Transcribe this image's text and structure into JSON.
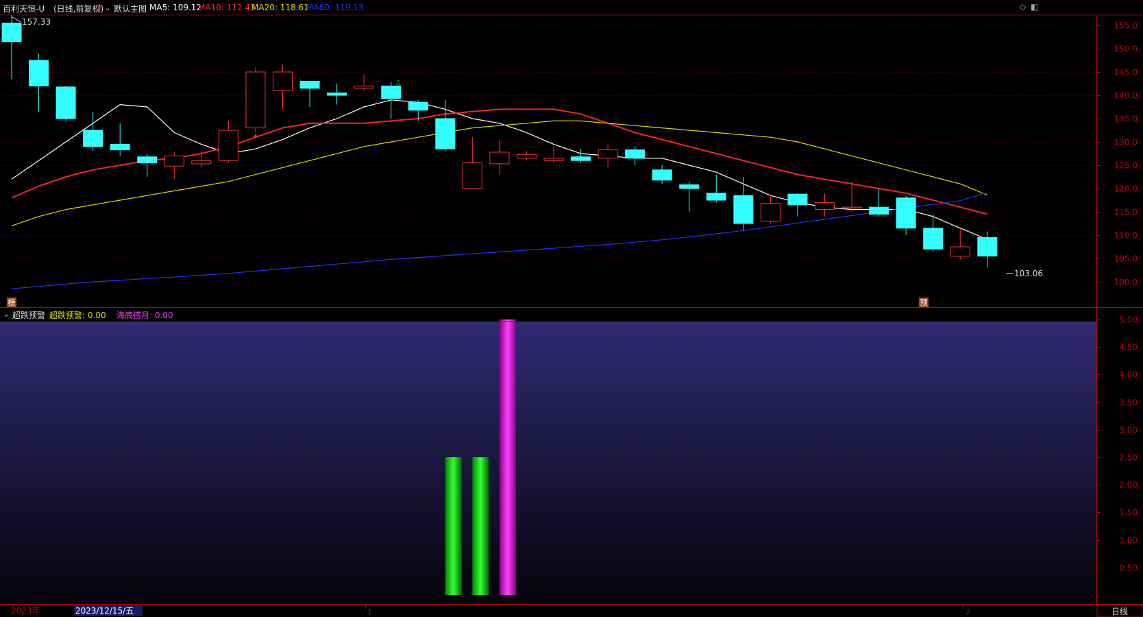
{
  "header": {
    "stock": "百利天恒-U",
    "period": "(日线,前复权)",
    "main_chart": "默认主图",
    "ma5": "MA5: 109.12",
    "ma10": "MA10: 112.43",
    "ma20": "MA20: 118.61",
    "ma60": "MA60: 119.13"
  },
  "price_chart": {
    "high_mark": "157.33",
    "low_mark": "103.06",
    "left_tag": "榜",
    "right_tag": "预"
  },
  "indicator": {
    "name": "超跌预警",
    "value1": "超跌预警: 0.00",
    "value2": "海底捞月: 0.00"
  },
  "bottom_bar": {
    "year": "2023年",
    "cursor_date": "2023/12/15/五",
    "month1": "1",
    "month2": "2",
    "period_button": "日线"
  },
  "colors": {
    "up": "#ff3333",
    "down": "#33ffff",
    "ma5": "#ffffff",
    "ma10": "#ff2222",
    "ma20": "#dddd00",
    "ma60": "#2233ff",
    "axis": "#c00000"
  },
  "chart_data": [
    {
      "type": "candlestick",
      "title": "百利天恒-U (日线,前复权)",
      "y_ticks": [
        "155.0",
        "150.0",
        "145.0",
        "140.0",
        "135.0",
        "130.0",
        "125.0",
        "120.0",
        "115.0",
        "110.0",
        "105.0",
        "100.0"
      ],
      "ylim": [
        98,
        159
      ],
      "candles": [
        {
          "o": 155.5,
          "h": 157.33,
          "l": 143.5,
          "c": 151.5
        },
        {
          "o": 147.5,
          "h": 149.0,
          "l": 136.5,
          "c": 142.0
        },
        {
          "o": 141.8,
          "h": 142.0,
          "l": 134.5,
          "c": 135.0
        },
        {
          "o": 132.5,
          "h": 136.5,
          "l": 128.0,
          "c": 129.0
        },
        {
          "o": 129.5,
          "h": 134.0,
          "l": 127.0,
          "c": 128.3
        },
        {
          "o": 126.8,
          "h": 127.5,
          "l": 122.5,
          "c": 125.5
        },
        {
          "o": 124.8,
          "h": 127.8,
          "l": 122.0,
          "c": 127.0
        },
        {
          "o": 125.3,
          "h": 128.0,
          "l": 124.5,
          "c": 126.0
        },
        {
          "o": 126.0,
          "h": 134.5,
          "l": 125.5,
          "c": 132.5
        },
        {
          "o": 133.0,
          "h": 146.0,
          "l": 132.0,
          "c": 145.0
        },
        {
          "o": 141.0,
          "h": 146.5,
          "l": 137.0,
          "c": 145.0
        },
        {
          "o": 143.0,
          "h": 143.0,
          "l": 137.5,
          "c": 141.5
        },
        {
          "o": 140.5,
          "h": 142.5,
          "l": 138.0,
          "c": 140.0
        },
        {
          "o": 141.5,
          "h": 144.5,
          "l": 141.0,
          "c": 142.0
        },
        {
          "o": 142.0,
          "h": 143.0,
          "l": 135.0,
          "c": 139.3
        },
        {
          "o": 138.5,
          "h": 139.0,
          "l": 134.5,
          "c": 136.8
        },
        {
          "o": 135.0,
          "h": 139.0,
          "l": 128.0,
          "c": 128.5
        },
        {
          "o": 120.0,
          "h": 131.0,
          "l": 120.0,
          "c": 125.5
        },
        {
          "o": 125.3,
          "h": 130.5,
          "l": 123.0,
          "c": 127.8
        },
        {
          "o": 126.5,
          "h": 128.0,
          "l": 126.0,
          "c": 127.3
        },
        {
          "o": 126.0,
          "h": 129.0,
          "l": 125.5,
          "c": 126.5
        },
        {
          "o": 126.8,
          "h": 128.5,
          "l": 125.5,
          "c": 126.0
        },
        {
          "o": 126.5,
          "h": 129.5,
          "l": 124.5,
          "c": 128.3
        },
        {
          "o": 128.3,
          "h": 129.0,
          "l": 125.0,
          "c": 126.5
        },
        {
          "o": 124.0,
          "h": 125.0,
          "l": 121.0,
          "c": 121.8
        },
        {
          "o": 120.8,
          "h": 121.5,
          "l": 115.0,
          "c": 120.0
        },
        {
          "o": 119.0,
          "h": 123.0,
          "l": 117.0,
          "c": 117.5
        },
        {
          "o": 118.5,
          "h": 122.5,
          "l": 111.0,
          "c": 112.5
        },
        {
          "o": 113.0,
          "h": 118.5,
          "l": 112.5,
          "c": 116.8
        },
        {
          "o": 118.8,
          "h": 119.0,
          "l": 114.0,
          "c": 116.5
        },
        {
          "o": 115.5,
          "h": 119.0,
          "l": 114.0,
          "c": 117.0
        },
        {
          "o": 116.0,
          "h": 121.5,
          "l": 115.0,
          "c": 116.0
        },
        {
          "o": 116.0,
          "h": 120.0,
          "l": 114.0,
          "c": 114.5
        },
        {
          "o": 118.0,
          "h": 118.5,
          "l": 110.0,
          "c": 111.5
        },
        {
          "o": 111.5,
          "h": 114.5,
          "l": 106.5,
          "c": 107.0
        },
        {
          "o": 105.5,
          "h": 111.5,
          "l": 104.8,
          "c": 107.5
        },
        {
          "o": 109.5,
          "h": 110.8,
          "l": 103.06,
          "c": 105.5
        }
      ],
      "series": [
        {
          "name": "MA5",
          "values": [
            122,
            126,
            130,
            134,
            138,
            137.5,
            132,
            129.5,
            127.5,
            128.5,
            130.5,
            133,
            135,
            137.5,
            139,
            138.5,
            137,
            135,
            134,
            132,
            129.5,
            127.5,
            127,
            126.5,
            126.5,
            125,
            123.5,
            121,
            118.5,
            117,
            116,
            115.5,
            115.5,
            115.5,
            114,
            111.5,
            109.12
          ]
        },
        {
          "name": "MA10",
          "values": [
            118,
            120.5,
            122.5,
            124,
            125,
            126,
            126.5,
            127.5,
            129,
            131,
            133,
            134,
            134,
            134,
            134.5,
            135,
            136,
            136.5,
            137,
            137,
            137,
            136,
            134,
            132,
            130.5,
            129,
            127.5,
            126,
            124.5,
            123,
            122,
            121,
            120,
            119,
            117.5,
            116,
            114.5
          ]
        },
        {
          "name": "MA20",
          "values": [
            112,
            114,
            115.5,
            116.5,
            117.5,
            118.5,
            119.5,
            120.5,
            121.5,
            123,
            124.5,
            126,
            127.5,
            129,
            130,
            131,
            132,
            133,
            133.5,
            134,
            134.5,
            134.5,
            134,
            133.5,
            133,
            132.5,
            132,
            131.5,
            131,
            130,
            128.5,
            127,
            125.5,
            124,
            122.5,
            121,
            118.61
          ]
        },
        {
          "name": "MA60",
          "values": [
            98.5,
            99,
            99.5,
            100,
            100.3,
            100.7,
            101,
            101.4,
            101.8,
            102.3,
            102.8,
            103.3,
            103.8,
            104.3,
            104.8,
            105.2,
            105.6,
            106,
            106.4,
            106.8,
            107.2,
            107.6,
            108,
            108.5,
            109,
            109.6,
            110.3,
            111,
            111.8,
            112.6,
            113.4,
            114.2,
            115,
            115.8,
            116.6,
            117.4,
            119.13
          ]
        }
      ]
    },
    {
      "type": "bar",
      "title": "超跌预警",
      "y_ticks": [
        "5.00",
        "4.50",
        "4.00",
        "3.50",
        "3.00",
        "2.50",
        "2.00",
        "1.50",
        "1.00",
        "0.50"
      ],
      "ylim": [
        0,
        5
      ],
      "series": [
        {
          "name": "超跌预警",
          "values": [
            {
              "index": 16,
              "value": 2.5
            },
            {
              "index": 17,
              "value": 2.5
            }
          ]
        },
        {
          "name": "海底捞月",
          "values": [
            {
              "index": 18,
              "value": 5.0
            }
          ]
        }
      ]
    }
  ]
}
